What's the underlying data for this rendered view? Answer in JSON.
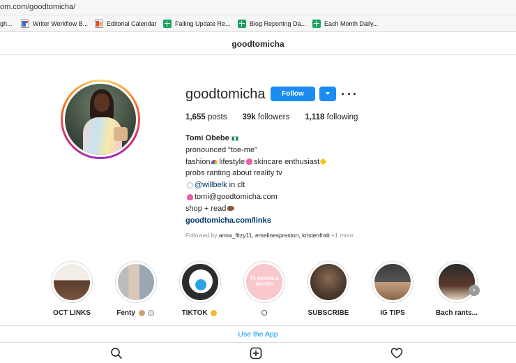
{
  "browser": {
    "url": "om.com/goodtomicha/",
    "bookmarks": [
      {
        "label": "gh...",
        "icon": "none"
      },
      {
        "label": "Writer Workflow B...",
        "icon": "doc-icon"
      },
      {
        "label": "Editorial Calendar",
        "icon": "red-doc-icon"
      },
      {
        "label": "Falling Update Re...",
        "icon": "sheets-icon"
      },
      {
        "label": "Blog Reporting Da...",
        "icon": "sheets-icon"
      },
      {
        "label": "Each Month Daily...",
        "icon": "sheets-icon"
      }
    ]
  },
  "header": {
    "title": "goodtomicha"
  },
  "profile": {
    "username": "goodtomicha",
    "follow_label": "Follow",
    "stats": {
      "posts_count": "1,655",
      "posts_label": "posts",
      "followers_count": "39k",
      "followers_label": "followers",
      "following_count": "1,118",
      "following_label": "following"
    },
    "bio": {
      "name": "Tomi Obebe",
      "line1": "pronounced “toe-me”",
      "line2a": "fashion",
      "line2b": "lifestyle",
      "line2c": "skincare enthusiast",
      "line3": "probs ranting about reality tv",
      "line4_user": "@willbelk",
      "line4_rest": " in clt",
      "line5": "tomi@goodtomicha.com",
      "line6": "shop + read",
      "link": "goodtomicha.com/links"
    },
    "followed_by": {
      "prefix": "Followed by ",
      "users": "anna_fitzy11, emelinespreston, kristenfratt",
      "more": " +1 more"
    }
  },
  "highlights": [
    {
      "label": "OCT LINKS"
    },
    {
      "label": "Fenty"
    },
    {
      "label": "TIKTOK"
    },
    {
      "label": "",
      "cover_text": "TV SHOWS & MOVIES"
    },
    {
      "label": "SUBSCRIBE"
    },
    {
      "label": "IG TIPS"
    },
    {
      "label": "Bach rants..."
    }
  ],
  "footer": {
    "use_app": "Use the App"
  },
  "nav": [
    "search-icon",
    "new-post-icon",
    "activity-heart-icon"
  ]
}
